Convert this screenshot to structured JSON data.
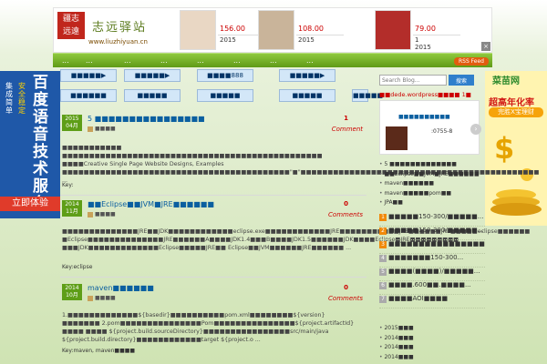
{
  "header": {
    "logo_seal": [
      "疆志",
      "远遠"
    ],
    "logo_script": "志远驿站",
    "logo_url": "www.liuzhiyuan.cn",
    "products": [
      {
        "price": "156.00",
        "year": "2015",
        "color": "#e9d7c4"
      },
      {
        "price": "108.00",
        "year": "2015",
        "color": "#c9b49a"
      },
      {
        "price": "79.00",
        "year": "2015",
        "year2": "1",
        "color": "#b32d2a"
      }
    ],
    "close_label": "×"
  },
  "nav": {
    "items": [
      "...",
      "...",
      "...",
      "...",
      "...",
      "...",
      "...",
      "..."
    ],
    "rss_label": "RSS Feed"
  },
  "left_ad": {
    "headline": "百度语音技术服务",
    "side1": "集成简单",
    "side2": "安全稳定",
    "cta": "立即体验"
  },
  "right_ad": {
    "name": "菜苗网",
    "headline": "超高年化率",
    "button": "完胜X宝理财"
  },
  "categories": [
    "■■■■■▶",
    "■■■■■▶",
    "■■■■888",
    "■■■■■▶",
    "■■■■■■",
    "■■■■■",
    "■■■■■",
    "■■■■■",
    "■■■■■"
  ],
  "posts": [
    {
      "year": "2015",
      "date": "04月",
      "title": "5 ■■■■■■■■■■■■■■■■",
      "category": "■■■■",
      "comment_count": "1",
      "comment_label": "Comment",
      "excerpt": "■■■■■■■■■■■ ■■■■■■■■■■■■■■■■■■■■■■■■■■■■■■■■■■■■■■■■■■■■■■■■ ■■■■Creative Single Page Website Designs, Examples ■■■■■■■■■■■■■■■■■■■■■■■■■■■■■■■■■■■■■■■■■■\"■\"■■■■■■■■■■■■■■■■■■■■■■■■■■■■■■■■■■■■■■■■■■■■ ...",
      "key": "Key:"
    },
    {
      "year": "2014",
      "date": "11月",
      "title": "■■Eclipse■■JVM■JRE■■■■■■",
      "category": "■■■■",
      "comment_count": "0",
      "comment_label": "Comments",
      "excerpt": "■■■■■■■■■■■■■■JRE■■JDK■■■■■■■■■■■■eclipse.exe■■■■■■■■■■■■JRE■■■■■■■■■■■JRE■■■■■■JRE■■■■■eclipse■■■■■■ ■Eclipse■■■■■■■■■■■■■■JRE■■■■■■A■■■■JDK1.4■■■B■■■■JDK1.5■■■■■■JDK■■■■Eclipse■JRE■■■■■■■■■ ■■■JDK■■■■■■■■■■■■■Eclipse■■■■■JRE■■ Eclipse■■JVM■■■■■■JRE■■■■■■ ...",
      "key": "Key:eclipse"
    },
    {
      "year": "2014",
      "date": "10月",
      "title": "maven■■■■■■",
      "category": "■■■■",
      "comment_count": "0",
      "comment_label": "Comments",
      "excerpt": "1.■■■■■■■■■■■■■${basedir}■■■■■■■■■■pom.xml■■■■■■■■${version}■■■■■■■ 2.pom■■■■■■■■■■■■■■■Pom■■■■■■■■■■■■■■■${project.artifactId} ■■■■ ■■■■ ${project.build.sourceDirectory}■■■■■■■■■■■■■■■■src/main/java ${project.build.directory}■■■■■■■■■■■■target ${project.o ...",
      "key": "Key:maven, maven■■■■"
    }
  ],
  "sidebar": {
    "search_placeholder": "Search Blog...",
    "search_button": "搜索",
    "dede_link": "■■dede.wordpress■■■■ 1■",
    "slide_title": "■■■■■■■■■■",
    "slide_phone": ":0755-8",
    "slide_arrow": "›",
    "recent": [
      "5 ■■■■■■■■■■■■■",
      "■■Eclipse■■JVM■JRE■■■■■■",
      "maven■■■■■■",
      "maven■■■■■pom■■",
      "JPA■■"
    ],
    "numbered": [
      {
        "n": "1",
        "text": "■■■■■150-300/■■■■■..."
      },
      {
        "n": "2",
        "text": "■■■■■150-300/■■■■■..."
      },
      {
        "n": "3",
        "text": "■■■■■■■■■■■■■■■■"
      },
      {
        "n": "4",
        "text": "■■■■■■■150-300..."
      },
      {
        "n": "5",
        "text": "■■■■(■■■■)/■■■■■..."
      },
      {
        "n": "6",
        "text": "■■■■.600■■.■■■■..."
      },
      {
        "n": "7",
        "text": "■■■■AOI■■■■"
      }
    ],
    "archives": [
      "2015■■■",
      "2014■■■",
      "2014■■■",
      "2014■■■"
    ]
  }
}
